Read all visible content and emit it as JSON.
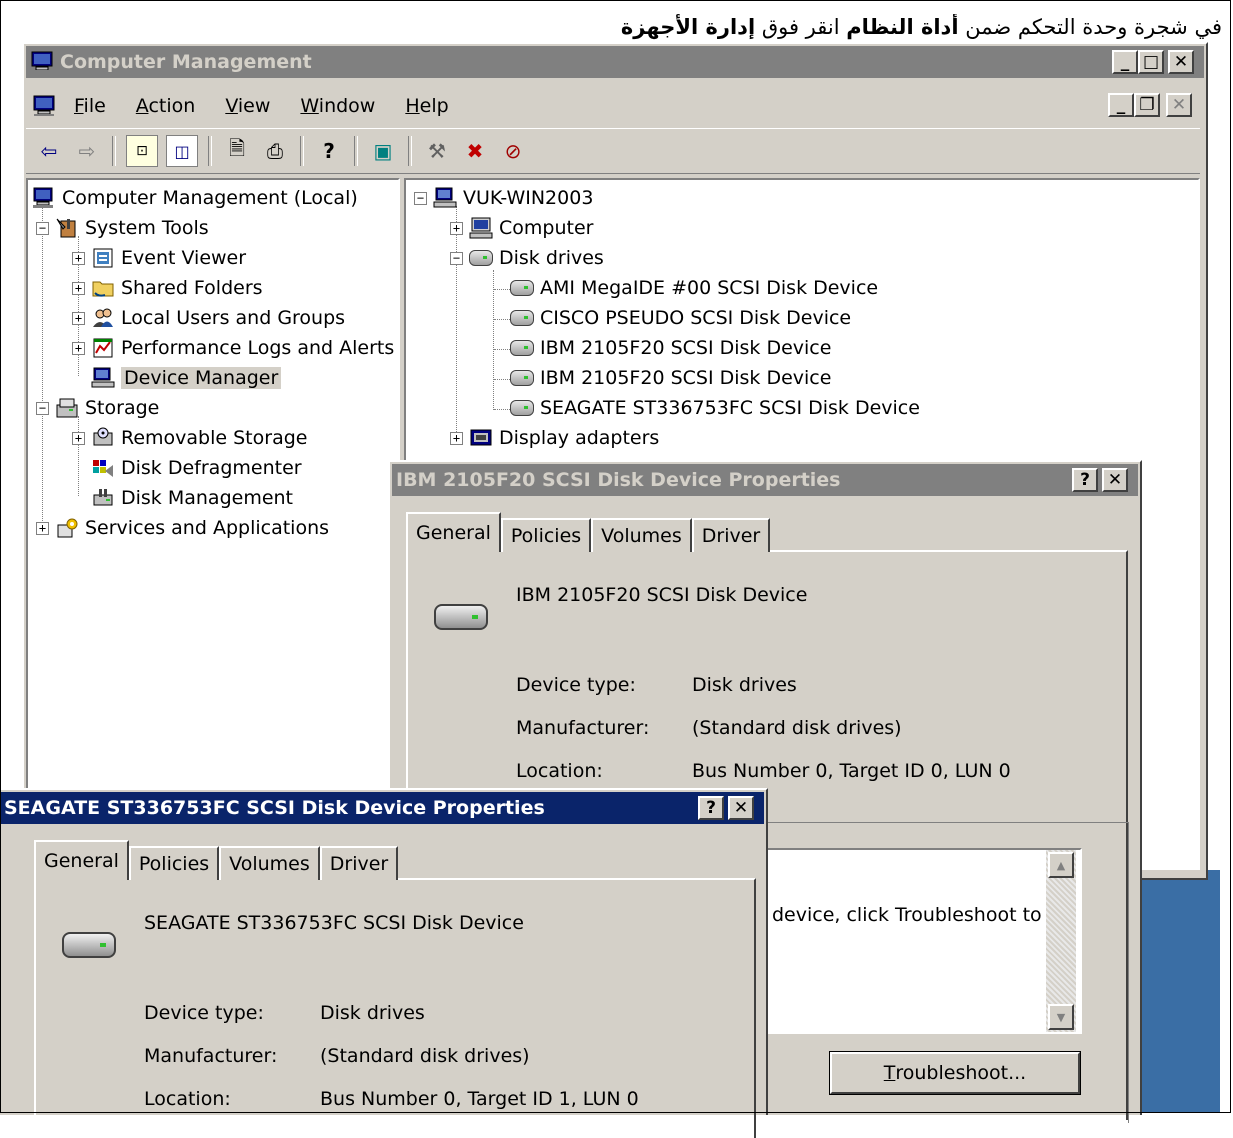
{
  "caption": {
    "text_before": "في شجرة وحدة التحكم ضمن ",
    "bold1": "أداة النظام",
    "text_mid": " انقر فوق ",
    "bold2": "إدارة الأجهزة"
  },
  "main_window": {
    "title": "Computer Management",
    "title_buttons": {
      "minimize": "_",
      "maximize": "□",
      "close": "✕"
    },
    "inner_buttons": {
      "minimize": "_",
      "restore": "❐",
      "close": "✕"
    },
    "menu": [
      {
        "underline": "F",
        "rest": "ile"
      },
      {
        "underline": "A",
        "rest": "ction"
      },
      {
        "underline": "V",
        "rest": "iew"
      },
      {
        "underline": "W",
        "rest": "indow"
      },
      {
        "underline": "H",
        "rest": "elp"
      }
    ]
  },
  "toolbar": {
    "back": "⇦",
    "forward": "⇨",
    "up": "⊡",
    "showhide": "◫",
    "properties": "🗎",
    "print": "⎙",
    "help": "?",
    "export": "▣",
    "scan": "⚒",
    "uninstall": "✖",
    "disable": "⊘"
  },
  "left_tree": [
    {
      "label": "Computer Management (Local)"
    },
    {
      "label": "System Tools"
    },
    {
      "label": "Event Viewer"
    },
    {
      "label": "Shared Folders"
    },
    {
      "label": "Local Users and Groups"
    },
    {
      "label": "Performance Logs and Alerts"
    },
    {
      "label": "Device Manager"
    },
    {
      "label": "Storage"
    },
    {
      "label": "Removable Storage"
    },
    {
      "label": "Disk Defragmenter"
    },
    {
      "label": "Disk Management"
    },
    {
      "label": "Services and Applications"
    }
  ],
  "right_tree": [
    {
      "label": "VUK-WIN2003"
    },
    {
      "label": "Computer"
    },
    {
      "label": "Disk drives"
    },
    {
      "label": "AMI MegaIDE #00 SCSI Disk Device"
    },
    {
      "label": "CISCO PSEUDO SCSI Disk Device"
    },
    {
      "label": "IBM 2105F20 SCSI Disk Device"
    },
    {
      "label": "IBM 2105F20 SCSI Disk Device"
    },
    {
      "label": "SEAGATE ST336753FC SCSI Disk Device"
    },
    {
      "label": "Display adapters"
    }
  ],
  "dialog_ibm": {
    "title": "IBM 2105F20 SCSI Disk Device Properties",
    "help_btn": "?",
    "close_btn": "✕",
    "tabs": [
      "General",
      "Policies",
      "Volumes",
      "Driver"
    ],
    "device_name": "IBM 2105F20 SCSI Disk Device",
    "device_type_label": "Device type:",
    "device_type": "Disk drives",
    "manufacturer_label": "Manufacturer:",
    "manufacturer": "(Standard disk drives)",
    "location_label": "Location:",
    "location": "Bus Number 0, Target ID 0, LUN 0",
    "status_text": "device, click Troubleshoot to",
    "troubleshoot_ul": "T",
    "troubleshoot_rest": "roubleshoot..."
  },
  "dialog_seagate": {
    "title": "SEAGATE ST336753FC SCSI Disk Device Properties",
    "help_btn": "?",
    "close_btn": "✕",
    "tabs": [
      "General",
      "Policies",
      "Volumes",
      "Driver"
    ],
    "device_name": "SEAGATE ST336753FC SCSI Disk Device",
    "device_type_label": "Device type:",
    "device_type": "Disk drives",
    "manufacturer_label": "Manufacturer:",
    "manufacturer": "(Standard disk drives)",
    "location_label": "Location:",
    "location": "Bus Number 0, Target ID 1, LUN 0"
  },
  "colors": {
    "desktop": "#3a6ea5",
    "face": "#d4d0c8",
    "active_title": "#0a246a",
    "inactive_title": "#808080"
  }
}
